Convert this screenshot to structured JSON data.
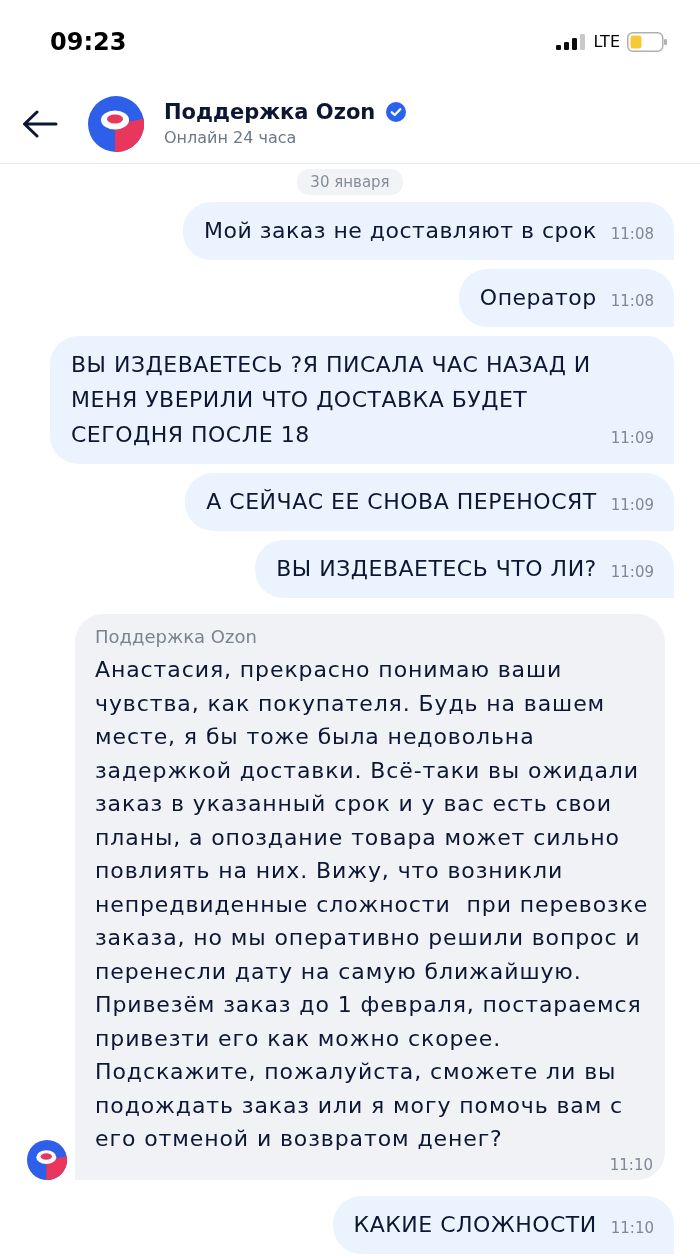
{
  "status_bar": {
    "time": "09:23",
    "network": "LTE"
  },
  "header": {
    "title": "Поддержка Ozon",
    "verified": true,
    "subtitle": "Онлайн 24 часа"
  },
  "date_label": "30 января",
  "messages": [
    {
      "kind": "outgoing",
      "text": "Мой заказ не доставляют в срок",
      "time": "11:08"
    },
    {
      "kind": "outgoing",
      "text": "Оператор",
      "time": "11:08"
    },
    {
      "kind": "outgoing",
      "text": "ВЫ ИЗДЕВАЕТЕСЬ ?Я ПИСАЛА ЧАС НАЗАД И МЕНЯ УВЕРИЛИ ЧТО ДОСТАВКА БУДЕТ СЕГОДНЯ ПОСЛЕ 18",
      "time": "11:09"
    },
    {
      "kind": "outgoing",
      "text": "А СЕЙЧАС ЕЕ СНОВА ПЕРЕНОСЯТ",
      "time": "11:09"
    },
    {
      "kind": "outgoing",
      "text": "ВЫ ИЗДЕВАЕТЕСЬ ЧТО ЛИ?",
      "time": "11:09"
    },
    {
      "kind": "incoming",
      "sender": "Поддержка Ozon",
      "text": "Анастасия, прекрасно понимаю ваши чувства, как покупателя. Будь на вашем месте, я бы тоже была недовольна задержкой доставки. Всё-таки вы ожидали заказ в указанный срок и у вас есть свои планы, а опоздание товара может сильно повлиять на них. Вижу, что возникли непредвиденные сложности  при перевозке заказа, но мы оперативно решили вопрос и перенесли дату на самую ближайшую. Привезём заказ до 1 февраля, постараемся привезти его как можно скорее. Подскажите, пожалуйста, сможете ли вы подождать заказ или я могу помочь вам с его отменой и возвратом денег?",
      "time": "11:10"
    },
    {
      "kind": "outgoing",
      "text": "КАКИЕ СЛОЖНОСТИ",
      "time": "11:10"
    }
  ]
}
